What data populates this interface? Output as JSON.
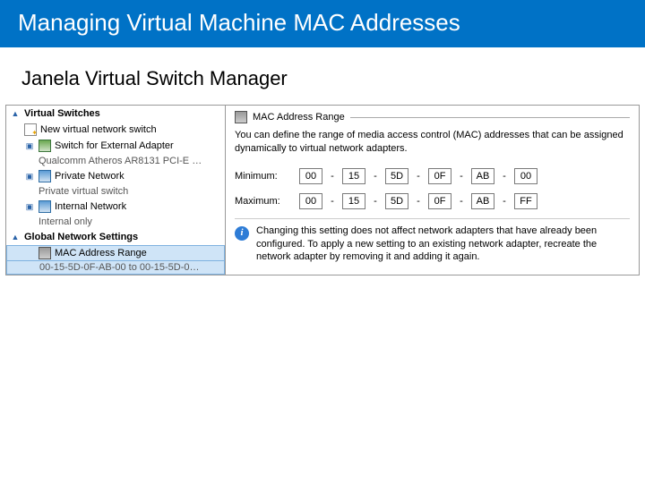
{
  "title": "Managing Virtual Machine MAC Addresses",
  "subtitle": "Janela Virtual Switch Manager",
  "tree": {
    "section_vs": "Virtual Switches",
    "new_switch": "New virtual network switch",
    "ext_label": "Switch for External Adapter",
    "ext_sub": "Qualcomm Atheros AR8131 PCI-E …",
    "priv_label": "Private Network",
    "priv_sub": "Private virtual switch",
    "int_label": "Internal Network",
    "int_sub": "Internal only",
    "section_global": "Global Network Settings",
    "mac_label": "MAC Address Range",
    "mac_sub": "00-15-5D-0F-AB-00 to 00-15-5D-0…"
  },
  "panel": {
    "group_title": "MAC Address Range",
    "description": "You can define the range of media access control (MAC) addresses that can be assigned dynamically to virtual network adapters.",
    "min_label": "Minimum:",
    "max_label": "Maximum:",
    "min": [
      "00",
      "15",
      "5D",
      "0F",
      "AB",
      "00"
    ],
    "max": [
      "00",
      "15",
      "5D",
      "0F",
      "AB",
      "FF"
    ],
    "sep": "-",
    "note": "Changing this setting does not affect network adapters that have already been configured.  To apply a new setting to an existing network adapter, recreate the network adapter by removing it and adding it again."
  }
}
